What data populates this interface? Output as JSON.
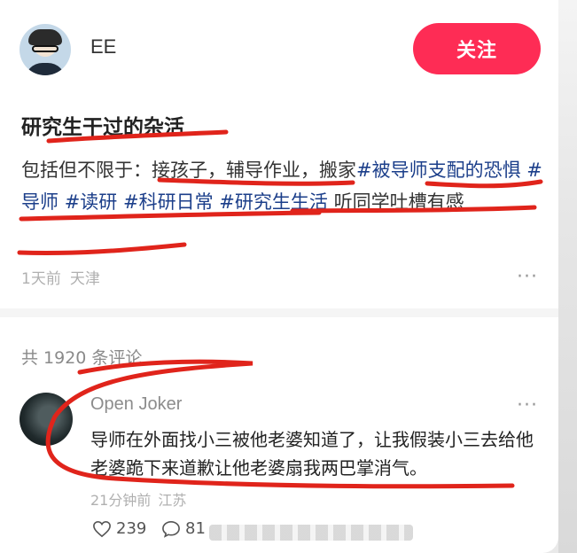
{
  "author": {
    "name": "EE",
    "follow_label": "关注"
  },
  "post": {
    "title": "研究生干过的杂活",
    "body_plain": "包括但不限于：接孩子，辅导作业，搬家",
    "tags": [
      "#被导师支配的恐惧",
      "#导师",
      "#读研",
      "#科研日常",
      "#研究生生活"
    ],
    "body_tail": " 听同学吐槽有感",
    "time": "1天前",
    "location": "天津",
    "more_glyph": "···"
  },
  "comments_header": "共 1920 条评论",
  "comment": {
    "user": "Open Joker",
    "text": "导师在外面找小三被他老婆知道了，让我假装小三去给他老婆跪下来道歉让他老婆扇我两巴掌消气。",
    "time": "21分钟前",
    "location": "江苏",
    "likes": "239",
    "replies": "81",
    "more_glyph": "···"
  },
  "colors": {
    "follow_button": "#fe2c55",
    "tag": "#1b3e8a",
    "annotation_red": "#e0241b"
  },
  "icons": [
    "heart-icon",
    "comment-bubble-icon",
    "more-dots-icon"
  ]
}
